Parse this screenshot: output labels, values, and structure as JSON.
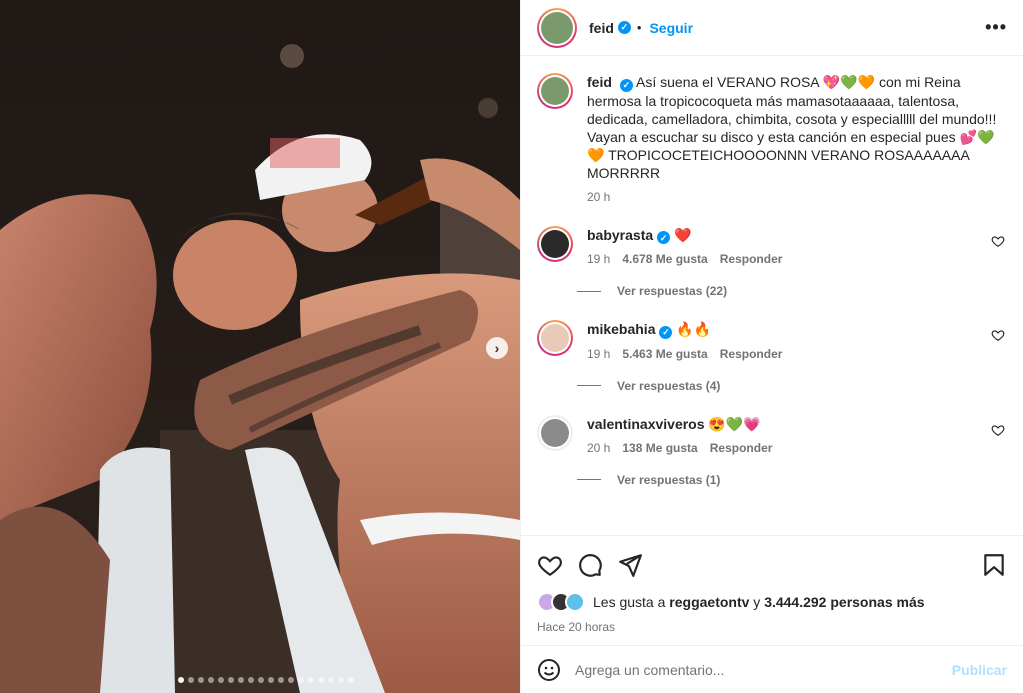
{
  "post": {
    "author": "feid",
    "follow_label": "Seguir",
    "more_label": "•••"
  },
  "caption": {
    "username": "feid",
    "text": "Así suena el VERANO ROSA 💖💚🧡 con mi Reina hermosa la tropicocoqueta más mamasotaaaaaa, talentosa, dedicada, camelladora, chimbita, cosota y especialllll del mundo!!! Vayan a escuchar su disco y esta canción en especial pues 💕💚🧡 TROPICOCETEICHOOOONNN VERANO ROSAAAAAAA MORRRRR",
    "time": "20 h"
  },
  "comments": [
    {
      "username": "babyrasta",
      "text": "❤️",
      "time": "19 h",
      "likes": "4.678 Me gusta",
      "reply_label": "Responder",
      "view_replies": "Ver respuestas (22)"
    },
    {
      "username": "mikebahia",
      "text": "🔥🔥",
      "time": "19 h",
      "likes": "5.463 Me gusta",
      "reply_label": "Responder",
      "view_replies": "Ver respuestas (4)"
    },
    {
      "username": "valentinaxviveros",
      "text": "😍💚💗",
      "time": "20 h",
      "likes": "138 Me gusta",
      "reply_label": "Responder",
      "view_replies": "Ver respuestas (1)"
    }
  ],
  "likes": {
    "prefix": "Les gusta a",
    "user": "reggaetontv",
    "joiner": "y",
    "rest": "3.444.292 personas más"
  },
  "posted_ago": "Hace 20 horas",
  "composer": {
    "placeholder": "Agrega un comentario...",
    "publish_label": "Publicar"
  },
  "carousel": {
    "total": 18,
    "active_index": 0
  },
  "colors": {
    "accent": "#0095f6",
    "muted": "#737373",
    "publish_disabled": "#b2dffc"
  }
}
